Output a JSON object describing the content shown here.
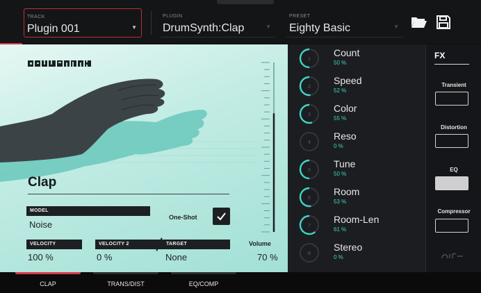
{
  "header": {
    "track": {
      "label": "TRACK",
      "value": "Plugin 001"
    },
    "plugin": {
      "label": "PLUGIN",
      "value": "DrumSynth:Clap"
    },
    "preset": {
      "label": "PRESET",
      "value": "Eighty Basic"
    }
  },
  "instrument": {
    "title": "Clap",
    "model_label": "MODEL",
    "model_value": "Noise",
    "one_shot_label": "One-Shot",
    "one_shot_checked": true,
    "velocity_label": "VELOCITY",
    "velocity_value": "100 %",
    "velocity2_label": "VELOCITY 2",
    "velocity2_value": "0 %",
    "target_label": "TARGET",
    "target_value": "None",
    "volume_label": "Volume",
    "volume_value": "70 %",
    "volume_level": 0.7
  },
  "knobs": [
    {
      "num": "1",
      "name": "Count",
      "pct": "50 %",
      "level": 0.5
    },
    {
      "num": "2",
      "name": "Speed",
      "pct": "52 %",
      "level": 0.52
    },
    {
      "num": "3",
      "name": "Color",
      "pct": "55 %",
      "level": 0.55
    },
    {
      "num": "4",
      "name": "Reso",
      "pct": "0 %",
      "level": 0
    },
    {
      "num": "5",
      "name": "Tune",
      "pct": "50 %",
      "level": 0.5
    },
    {
      "num": "6",
      "name": "Room",
      "pct": "53 %",
      "level": 0.53
    },
    {
      "num": "7",
      "name": "Room-Len",
      "pct": "61 %",
      "level": 0.61
    },
    {
      "num": "8",
      "name": "Stereo",
      "pct": "0 %",
      "level": 0
    }
  ],
  "fx": {
    "title": "FX",
    "items": [
      {
        "label": "Transient",
        "on": false
      },
      {
        "label": "Distortion",
        "on": false
      },
      {
        "label": "EQ",
        "on": true
      },
      {
        "label": "Compressor",
        "on": false
      }
    ]
  },
  "tabs": [
    {
      "label": "CLAP",
      "active": true
    },
    {
      "label": "TRANS/DIST",
      "active": false
    },
    {
      "label": "EQ/COMP",
      "active": false
    }
  ],
  "icons": {
    "folder": "folder-icon",
    "save": "save-icon",
    "dropdown": "caret-down-icon",
    "check": "check-icon",
    "brand": "air-logo"
  },
  "colors": {
    "accent": "#d63a47",
    "knob_active": "#3fd6c4",
    "panel_teal": "#a2e0d5"
  }
}
